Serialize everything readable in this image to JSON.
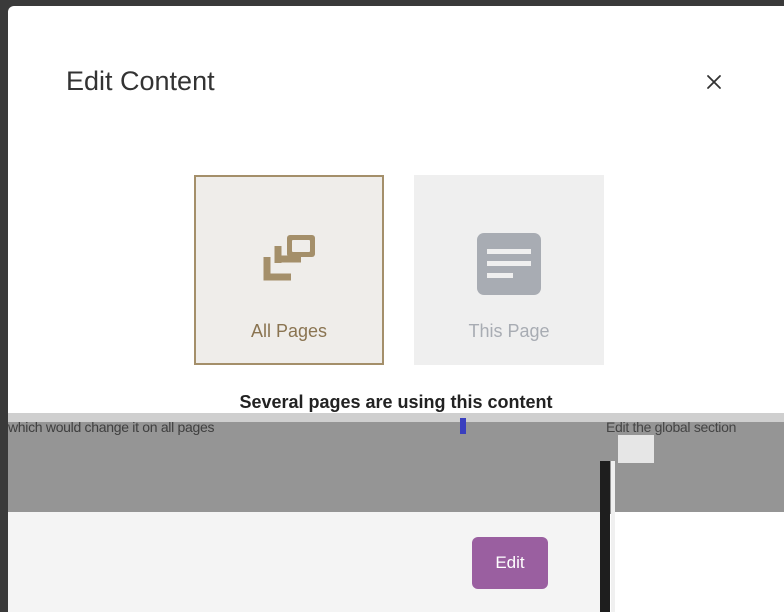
{
  "dialog": {
    "title": "Edit Content",
    "close_label": "×"
  },
  "options": [
    {
      "label": "All Pages",
      "icon": "stacked-pages-icon",
      "selected": true
    },
    {
      "label": "This Page",
      "icon": "single-page-icon",
      "selected": false
    }
  ],
  "note": {
    "text": "Several pages are using this content",
    "partial_left": "which would change it on all pages",
    "partial_right": "Edit the global section"
  },
  "footer": {
    "edit_label": "Edit"
  },
  "colors": {
    "selected_border": "#a48f6a",
    "selected_text": "#8a7451",
    "unselected_text": "#a8acb3",
    "edit_button": "#9a5fa0"
  }
}
